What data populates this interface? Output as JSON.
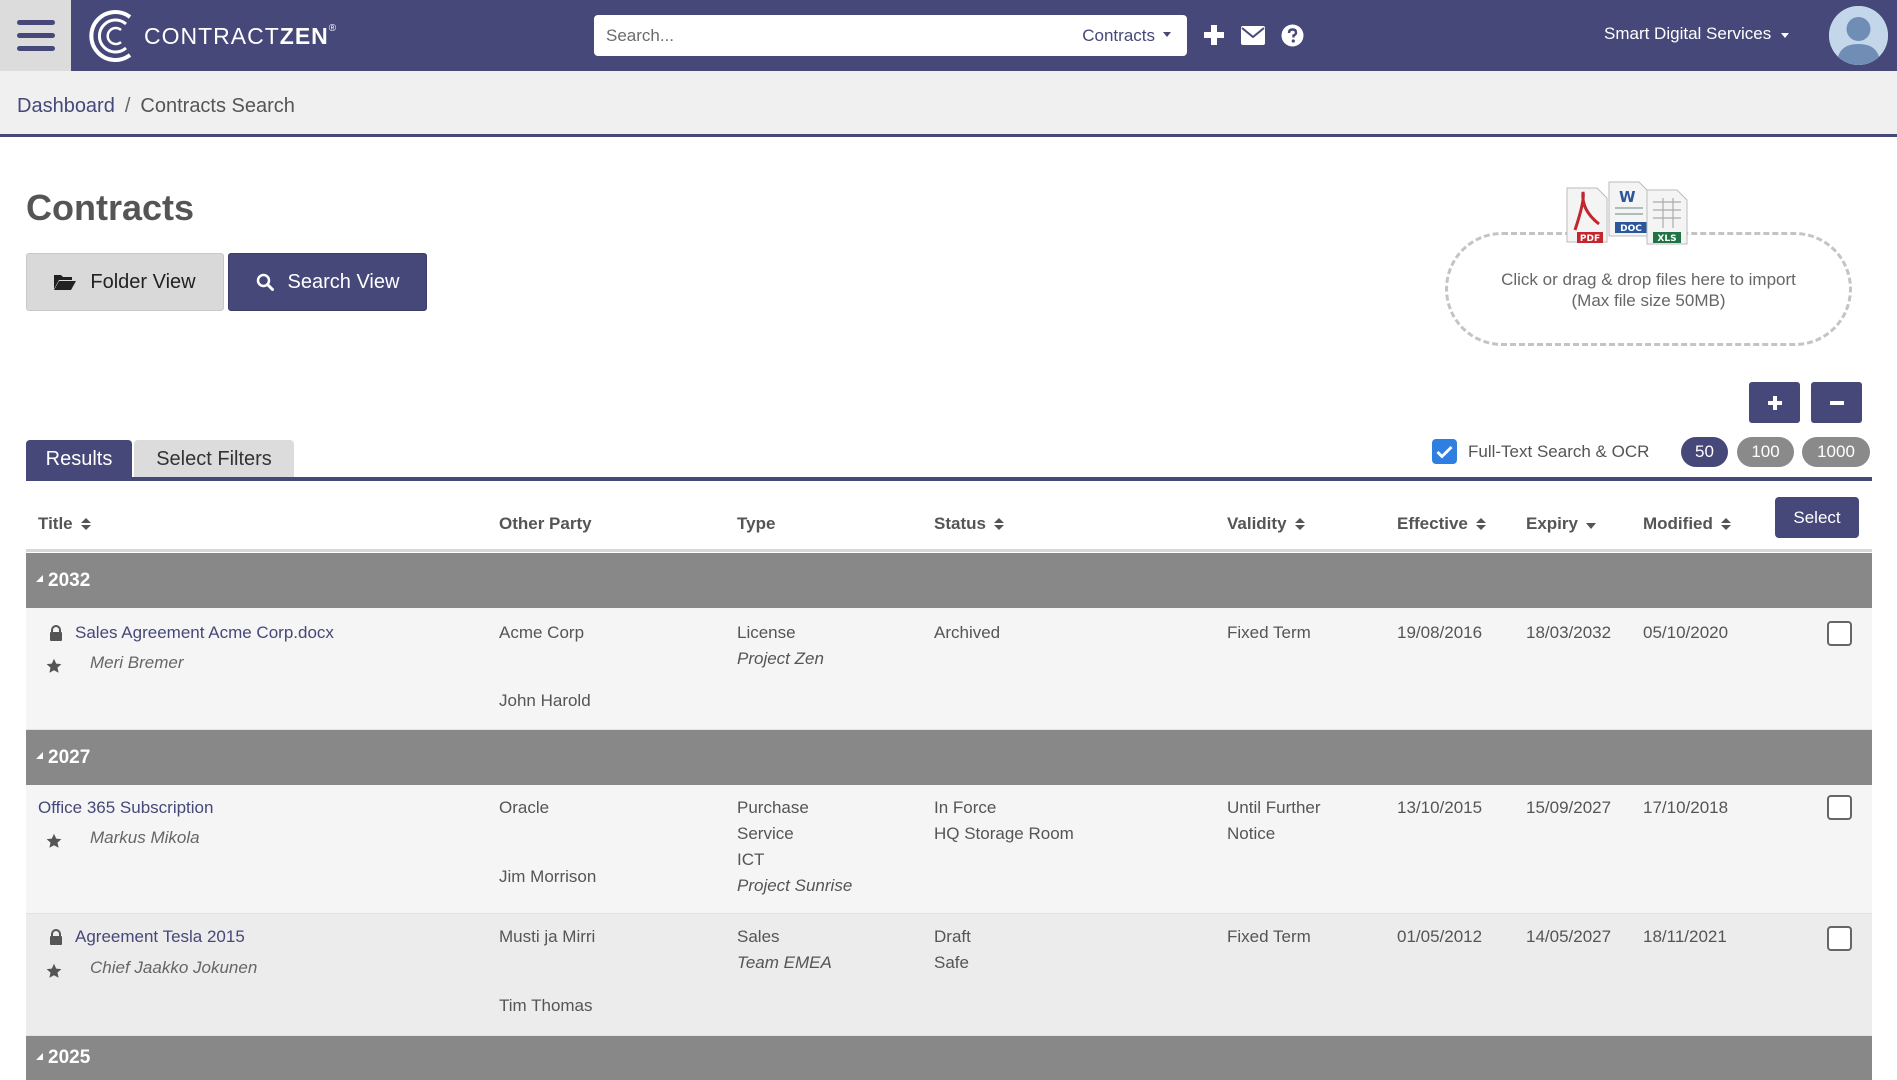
{
  "app": {
    "logo_text_light": "CONTRACT",
    "logo_text_bold": "ZEN",
    "logo_mark": "®"
  },
  "header": {
    "search_placeholder": "Search...",
    "search_scope": "Contracts",
    "account_name": "Smart Digital Services",
    "icons": [
      "plus-icon",
      "envelope-icon",
      "question-circle-icon"
    ]
  },
  "breadcrumb": {
    "home": "Dashboard",
    "separator": "/",
    "current": "Contracts Search"
  },
  "page": {
    "title": "Contracts",
    "folder_view_label": "Folder View",
    "search_view_label": "Search View"
  },
  "dropzone": {
    "line1": "Click or drag & drop files here to import",
    "line2": "(Max file size 50MB)",
    "file_badges": [
      "PDF",
      "W",
      "DOC",
      "XLS"
    ]
  },
  "tabs": {
    "results": "Results",
    "filters": "Select Filters"
  },
  "options": {
    "ocr_label": "Full-Text Search & OCR",
    "ocr_checked": true,
    "page_sizes": [
      "50",
      "100",
      "1000"
    ],
    "active_page_size": "50"
  },
  "table": {
    "columns": {
      "title": "Title",
      "other_party": "Other Party",
      "type": "Type",
      "status": "Status",
      "validity": "Validity",
      "effective": "Effective",
      "expiry": "Expiry",
      "modified": "Modified"
    },
    "select_label": "Select",
    "groups": [
      {
        "year": "2032",
        "rows": [
          {
            "title": "Sales Agreement Acme Corp.docx",
            "locked": true,
            "owner": "Meri Bremer",
            "other_party": "Acme Corp",
            "contact": "John Harold",
            "types": [
              "License"
            ],
            "project": "Project Zen",
            "status": [
              "Archived"
            ],
            "validity": "Fixed Term",
            "effective": "19/08/2016",
            "expiry": "18/03/2032",
            "modified": "05/10/2020"
          }
        ]
      },
      {
        "year": "2027",
        "rows": [
          {
            "title": "Office 365 Subscription",
            "locked": false,
            "owner": "Markus Mikola",
            "other_party": "Oracle",
            "contact": "Jim Morrison",
            "types": [
              "Purchase",
              "Service",
              "ICT"
            ],
            "project": "Project Sunrise",
            "status": [
              "In Force",
              "HQ Storage Room"
            ],
            "validity": "Until Further Notice",
            "validity_lines": [
              "Until Further",
              "Notice"
            ],
            "effective": "13/10/2015",
            "expiry": "15/09/2027",
            "modified": "17/10/2018"
          },
          {
            "title": "Agreement Tesla 2015",
            "locked": true,
            "owner": "Chief Jaakko Jokunen",
            "other_party": "Musti ja Mirri",
            "contact": "Tim Thomas",
            "types": [
              "Sales"
            ],
            "project": "Team EMEA",
            "status": [
              "Draft",
              "Safe"
            ],
            "validity": "Fixed Term",
            "effective": "01/05/2012",
            "expiry": "14/05/2027",
            "modified": "18/11/2021"
          }
        ]
      },
      {
        "year": "2025",
        "rows": []
      }
    ]
  },
  "colors": {
    "brand": "#454878",
    "group_row": "#888888",
    "checkbox_checked": "#2f7fe0"
  }
}
